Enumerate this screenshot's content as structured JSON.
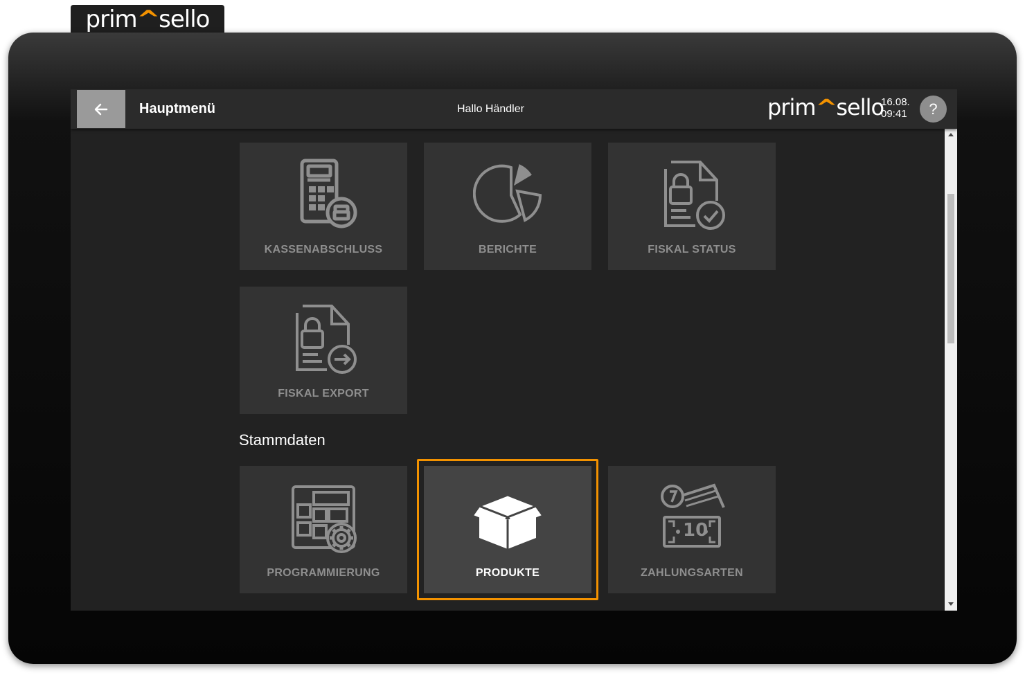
{
  "brand": {
    "logo_left": "prim",
    "logo_caret": "^",
    "logo_right": "sello"
  },
  "header": {
    "back_icon": "arrow-left-icon",
    "title": "Hauptmenü",
    "greeting": "Hallo Händler",
    "date": "16.08.",
    "time": "09:41",
    "help_label": "?"
  },
  "tiles_top": [
    {
      "label": "KASSENABSCHLUSS",
      "icon": "calculator-printer-icon"
    },
    {
      "label": "BERICHTE",
      "icon": "pie-chart-icon"
    },
    {
      "label": "FISKAL STATUS",
      "icon": "document-lock-check-icon"
    },
    {
      "label": "FISKAL EXPORT",
      "icon": "document-lock-export-icon"
    }
  ],
  "sections": {
    "stammdaten": "Stammdaten"
  },
  "tiles_stammdaten": [
    {
      "label": "PROGRAMMIERUNG",
      "icon": "layout-gear-icon"
    },
    {
      "label": "PRODUKTE",
      "icon": "open-box-icon",
      "selected": true
    },
    {
      "label": "ZAHLUNGSARTEN",
      "icon": "cash-coin-icon"
    }
  ],
  "colors": {
    "accent": "#f39200",
    "tile": "#333333",
    "tile_active": "#444444",
    "background": "#222222",
    "icon": "#8f8f8f"
  }
}
